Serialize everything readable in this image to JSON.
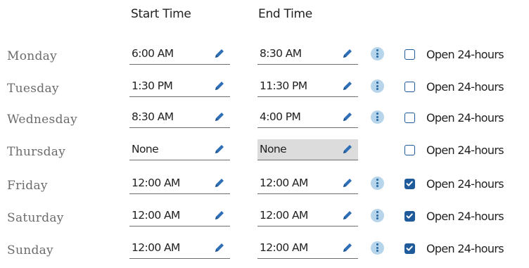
{
  "headers": {
    "start": "Start Time",
    "end": "End Time"
  },
  "days": [
    {
      "day": "Monday",
      "start": "6:00 AM",
      "end": "8:30 AM",
      "info": true,
      "open24": false,
      "end_disabled": false
    },
    {
      "day": "Tuesday",
      "start": "1:30 PM",
      "end": "11:30 PM",
      "info": true,
      "open24": false,
      "end_disabled": false
    },
    {
      "day": "Wednesday",
      "start": "8:30 AM",
      "end": "4:00 PM",
      "info": true,
      "open24": false,
      "end_disabled": false
    },
    {
      "day": "Thursday",
      "start": "None",
      "end": "None",
      "info": false,
      "open24": false,
      "end_disabled": true
    },
    {
      "day": "Friday",
      "start": "12:00 AM",
      "end": "12:00 AM",
      "info": true,
      "open24": true,
      "end_disabled": false
    },
    {
      "day": "Saturday",
      "start": "12:00 AM",
      "end": "12:00 AM",
      "info": true,
      "open24": true,
      "end_disabled": false
    },
    {
      "day": "Sunday",
      "start": "12:00 AM",
      "end": "12:00 AM",
      "info": true,
      "open24": true,
      "end_disabled": false
    }
  ],
  "open24_label": "Open 24-hours",
  "icons": {
    "edit": "pencil-icon",
    "info": "info-icon",
    "check": "checkmark-icon"
  },
  "colors": {
    "accent": "#1f5a9a",
    "pencil": "#2e6fb6",
    "info_bg": "#b7d5ea",
    "disabled_field": "#dcdcdc",
    "day_text": "#6b6b6b"
  }
}
